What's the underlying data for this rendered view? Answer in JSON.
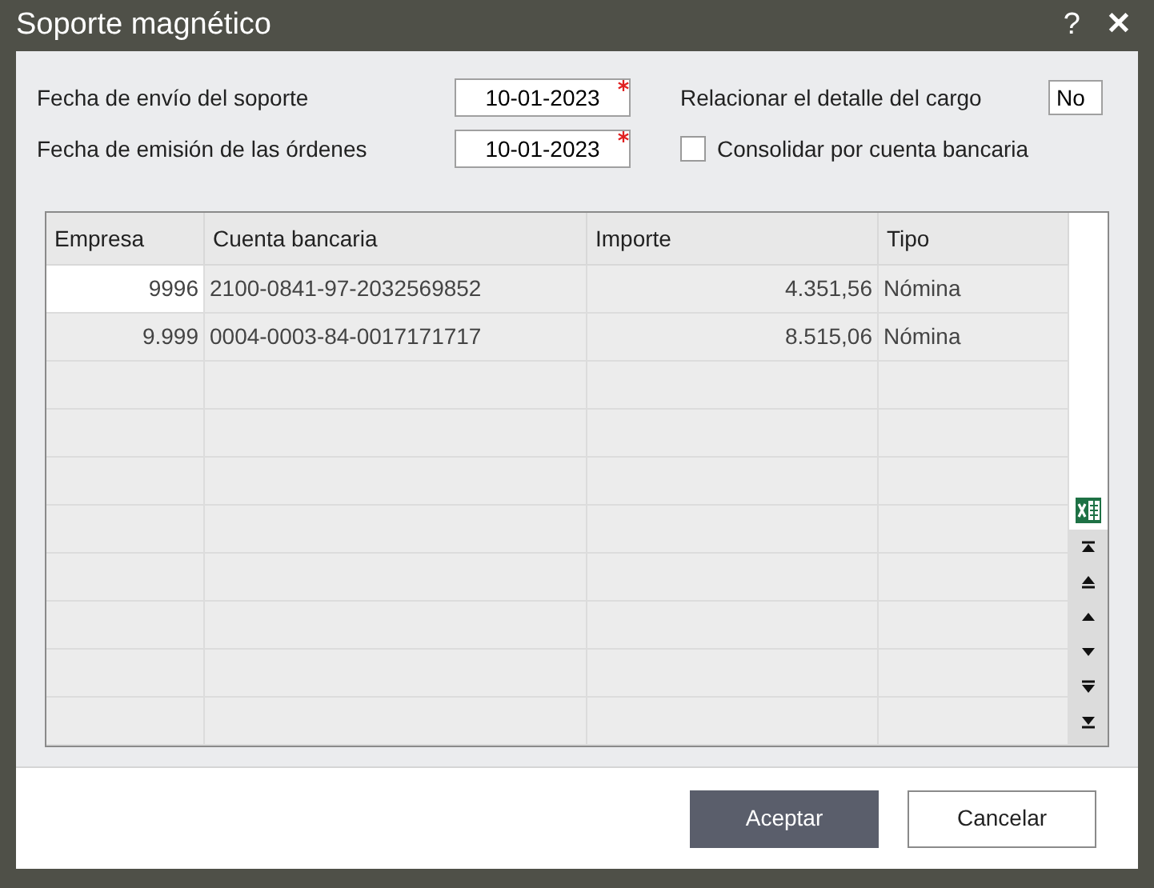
{
  "window": {
    "title": "Soporte magnético",
    "help": "?",
    "close": "✕"
  },
  "form": {
    "fields": [
      {
        "kind": "date",
        "label": "Fecha de envío del soporte",
        "value": "10-01-2023",
        "required": true
      },
      {
        "kind": "date",
        "label": "Fecha de emisión de las órdenes",
        "value": "10-01-2023",
        "required": true
      }
    ],
    "options": [
      {
        "kind": "text",
        "label": "Relacionar el detalle del cargo",
        "value": "No"
      },
      {
        "kind": "checkbox",
        "label": "Consolidar por cuenta bancaria",
        "checked": false
      }
    ]
  },
  "table": {
    "columns": [
      "Empresa",
      "Cuenta bancaria",
      "Importe",
      "Tipo"
    ],
    "rows": [
      {
        "selected": true,
        "cells": [
          "9996",
          "2100-0841-97-2032569852",
          "4.351,56",
          "Nómina"
        ]
      },
      {
        "selected": false,
        "cells": [
          "9.999",
          "0004-0003-84-0017171717",
          "8.515,06",
          "Nómina"
        ]
      }
    ]
  },
  "buttons": [
    {
      "label": "Aceptar",
      "kind": "primary"
    },
    {
      "label": "Cancelar",
      "kind": "secondary"
    }
  ]
}
